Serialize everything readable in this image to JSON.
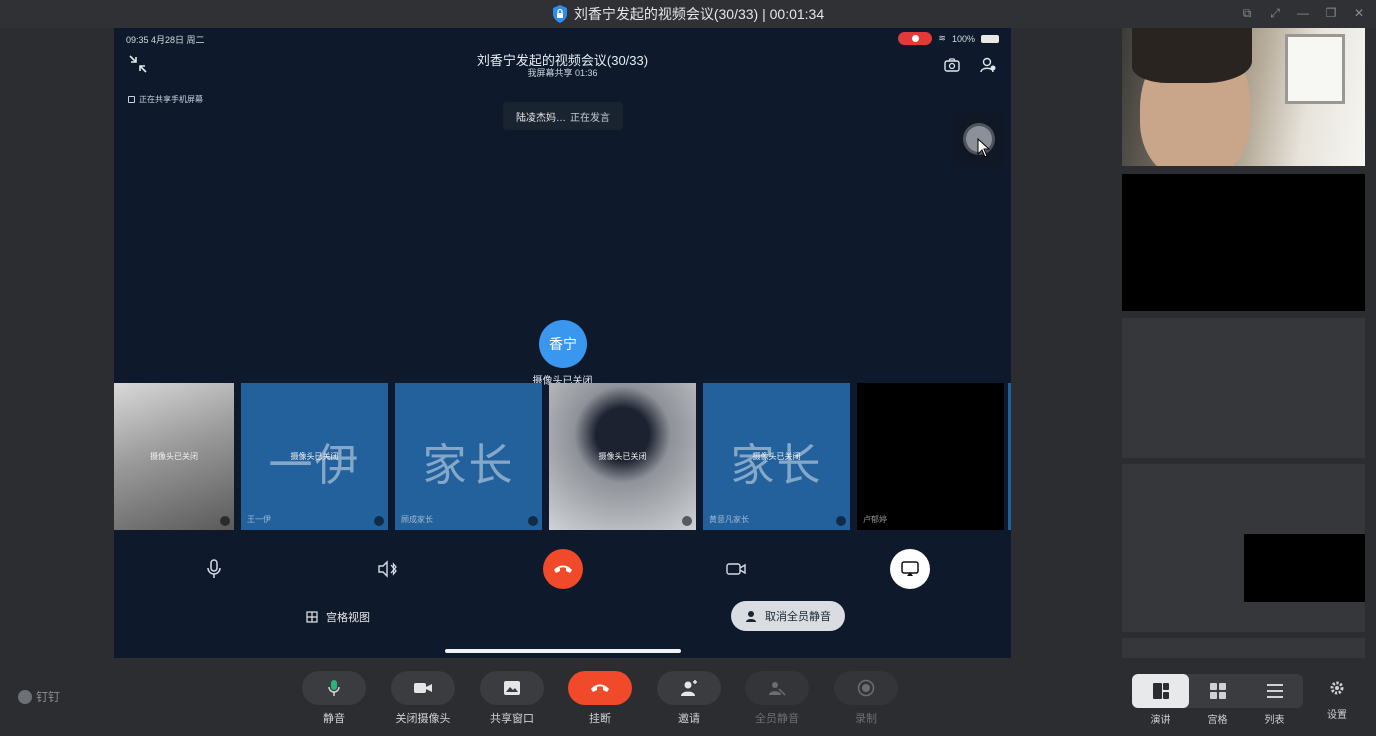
{
  "window": {
    "title": "刘香宁发起的视频会议(30/33) | 00:01:34"
  },
  "phone": {
    "status_time": "09:35  4月28日 周二",
    "battery": "100%",
    "conf_title": "刘香宁发起的视频会议(30/33)",
    "conf_sub": "我屏幕共享  01:36",
    "sharing_note": "正在共享手机屏幕",
    "speaking_name": "陆凌杰妈…",
    "speaking_status": "正在发言",
    "avatar_text": "香宁",
    "camera_off": "摄像头已关闭",
    "thumbnails": [
      {
        "kind": "photo",
        "big": "",
        "center": "摄像头已关闭",
        "name": ""
      },
      {
        "kind": "blue",
        "big": "一伊",
        "center": "摄像头已关闭",
        "name": "王一伊"
      },
      {
        "kind": "blue",
        "big": "家长",
        "center": "",
        "name": "顾成家长"
      },
      {
        "kind": "photo2",
        "big": "",
        "center": "摄像头已关闭",
        "name": ""
      },
      {
        "kind": "blue",
        "big": "家长",
        "center": "摄像头已关闭",
        "name": "黄意凡家长"
      },
      {
        "kind": "black",
        "big": "",
        "center": "",
        "name": "卢郁婷"
      }
    ],
    "grid_view_label": "宫格视图",
    "unmute_all_label": "取消全员静音"
  },
  "toolbar": {
    "brand": "钉钉",
    "buttons": [
      {
        "label": "静音",
        "icon": "mic-icon",
        "style": "normal"
      },
      {
        "label": "关闭摄像头",
        "icon": "camera-icon",
        "style": "normal"
      },
      {
        "label": "共享窗口",
        "icon": "share-window-icon",
        "style": "normal"
      },
      {
        "label": "挂断",
        "icon": "hangup-icon",
        "style": "red"
      },
      {
        "label": "邀请",
        "icon": "invite-icon",
        "style": "normal"
      },
      {
        "label": "全员静音",
        "icon": "mute-all-icon",
        "style": "disabled"
      },
      {
        "label": "录制",
        "icon": "record-icon",
        "style": "disabled"
      }
    ],
    "views": [
      "演讲",
      "宫格",
      "列表"
    ],
    "active_view": "演讲",
    "settings_label": "设置"
  },
  "colors": {
    "hangup": "#f04a2a",
    "avatar": "#3a97f0",
    "thumb_blue": "#23619c"
  }
}
